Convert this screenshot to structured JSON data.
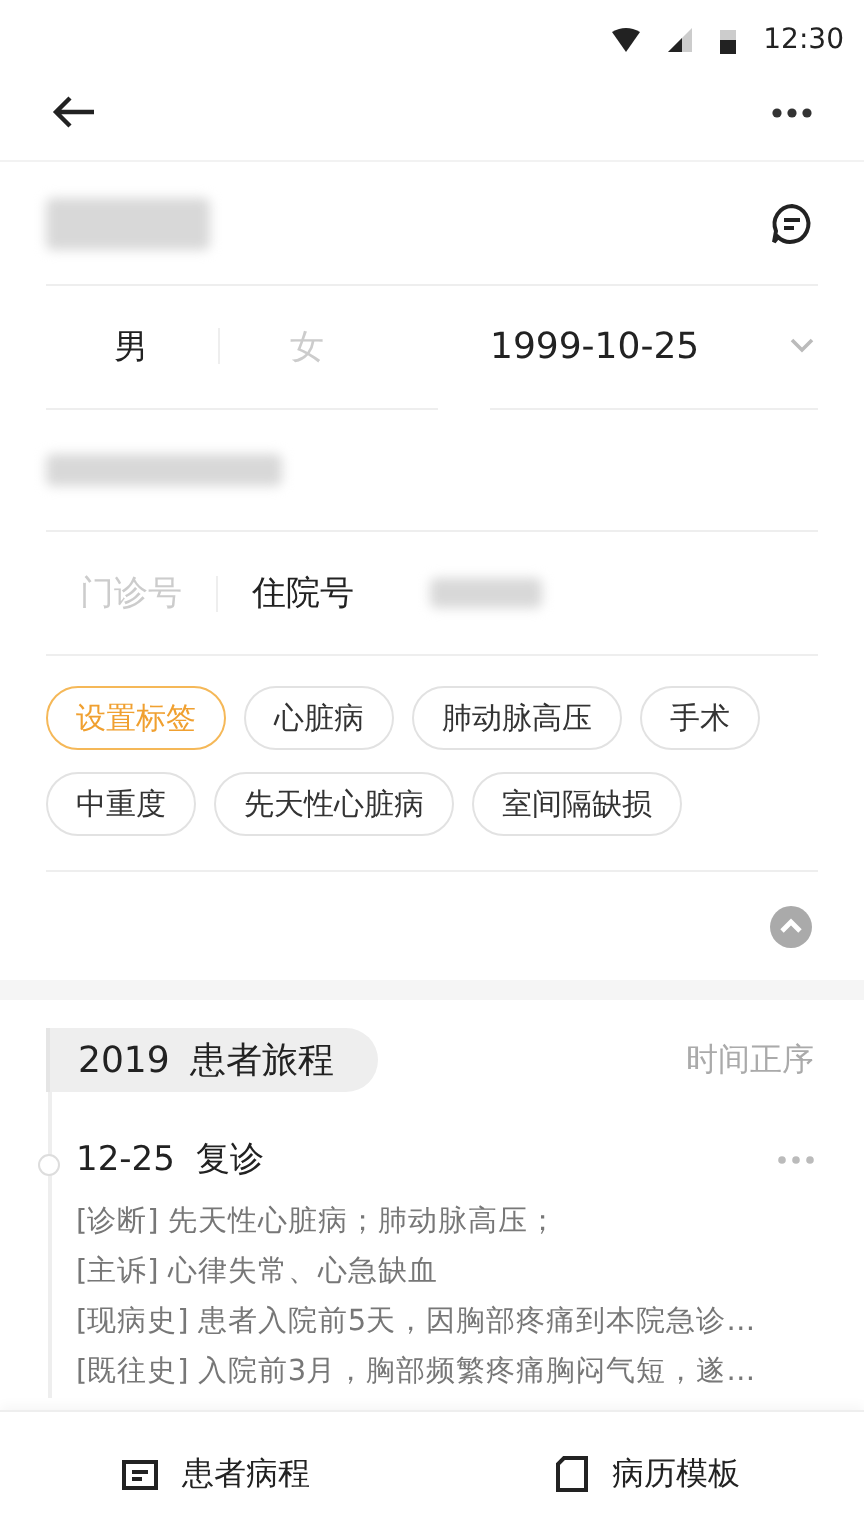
{
  "status_bar": {
    "time": "12:30"
  },
  "profile": {
    "genders": [
      {
        "label": "男",
        "selected": true
      },
      {
        "label": "女",
        "selected": false
      }
    ],
    "birth_date": "1999-10-25",
    "number_types": [
      {
        "label": "门诊号",
        "selected": false
      },
      {
        "label": "住院号",
        "selected": true
      }
    ],
    "tags": [
      {
        "label": "设置标签",
        "kind": "action"
      },
      {
        "label": "心脏病",
        "kind": "tag"
      },
      {
        "label": "肺动脉高压",
        "kind": "tag"
      },
      {
        "label": "手术",
        "kind": "tag"
      },
      {
        "label": "中重度",
        "kind": "tag"
      },
      {
        "label": "先天性心脏病",
        "kind": "tag"
      },
      {
        "label": "室间隔缺损",
        "kind": "tag"
      }
    ]
  },
  "journey": {
    "year": "2019",
    "title": "患者旅程",
    "sort": "时间正序",
    "entries": [
      {
        "date": "12-25",
        "type": "复诊",
        "lines": [
          "[诊断] 先天性心脏病；肺动脉高压；",
          "[主诉] 心律失常、心急缺血",
          "[现病史] 患者入院前5天，因胸部疼痛到本院急诊…",
          "[既往史] 入院前3月，胸部频繁疼痛胸闷气短，遂…"
        ]
      }
    ]
  },
  "bottom_tabs": [
    {
      "label": "患者病程",
      "kind": "record"
    },
    {
      "label": "病历模板",
      "kind": "template"
    }
  ]
}
